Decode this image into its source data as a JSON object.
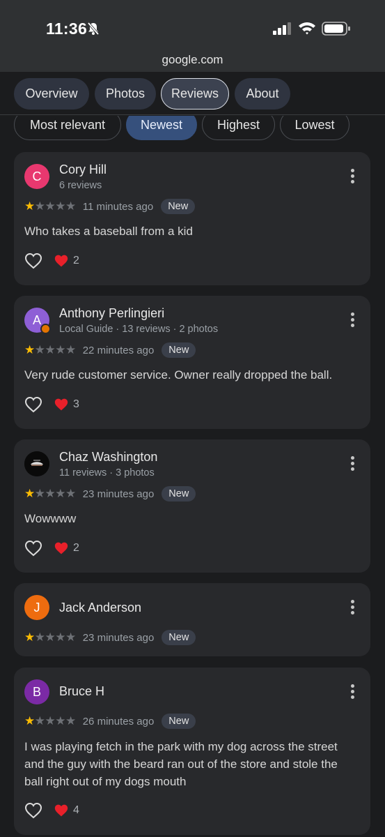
{
  "status_bar": {
    "time": "11:36",
    "url": "google.com"
  },
  "tabs": [
    {
      "label": "Overview",
      "active": false
    },
    {
      "label": "Photos",
      "active": false
    },
    {
      "label": "Reviews",
      "active": true
    },
    {
      "label": "About",
      "active": false
    }
  ],
  "sort_chips": [
    {
      "label": "Most relevant",
      "active": false
    },
    {
      "label": "Newest",
      "active": true
    },
    {
      "label": "Highest",
      "active": false
    },
    {
      "label": "Lowest",
      "active": false
    }
  ],
  "reviews": [
    {
      "avatar_letter": "C",
      "avatar_color": "#e8386f",
      "name": "Cory Hill",
      "meta": "6 reviews",
      "rating": 1,
      "time": "11 minutes ago",
      "tag": "New",
      "text": "Who takes a baseball from a kid",
      "likes": "2"
    },
    {
      "avatar_letter": "A",
      "avatar_color": "#8e5fd6",
      "local_guide": true,
      "name": "Anthony Perlingieri",
      "meta": "Local Guide · 13 reviews · 2 photos",
      "rating": 1,
      "time": "22 minutes ago",
      "tag": "New",
      "text": "Very rude customer service. Owner really dropped the ball.",
      "likes": "3"
    },
    {
      "avatar_letter": "",
      "avatar_color": "#0a0a0a",
      "avatar_photo": true,
      "name": "Chaz Washington",
      "meta": "11 reviews · 3 photos",
      "rating": 1,
      "time": "23 minutes ago",
      "tag": "New",
      "text": "Wowwww",
      "likes": "2"
    },
    {
      "avatar_letter": "J",
      "avatar_color": "#ee6c0f",
      "name": "Jack Anderson",
      "meta": "",
      "rating": 1,
      "time": "23 minutes ago",
      "tag": "New",
      "text": "",
      "likes": ""
    },
    {
      "avatar_letter": "B",
      "avatar_color": "#7b2aa5",
      "name": "Bruce H",
      "meta": "",
      "rating": 1,
      "time": "26 minutes ago",
      "tag": "New",
      "text": "I was playing fetch in the park with my dog across the street and the guy with the beard ran out of the store and stole the ball right out of my dogs mouth",
      "likes": "4"
    }
  ]
}
